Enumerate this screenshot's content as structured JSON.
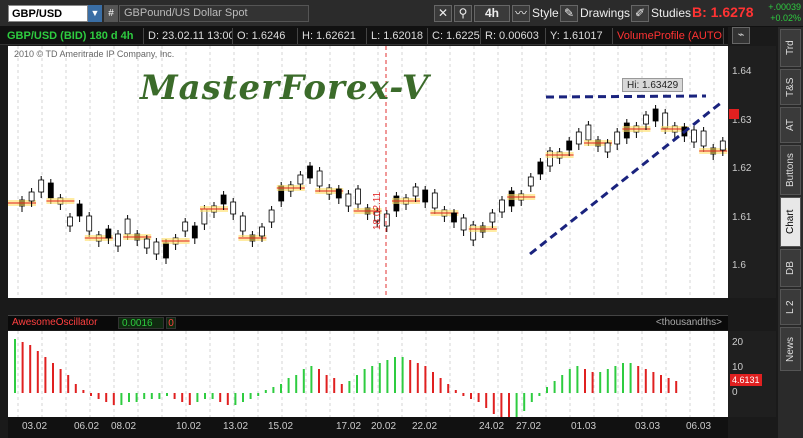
{
  "toolbar": {
    "symbol": "GBP/USD",
    "symbol_description": "GBPound/US Dollar Spot",
    "timeframe": "4h",
    "style_label": "Style",
    "drawings_label": "Drawings",
    "studies_label": "Studies",
    "bid_label": "B: 1.6278",
    "change_abs": "+.00039",
    "change_pct": "+0.02%"
  },
  "infobar": {
    "instrument": "GBP/USD (BID) 180 d 4h",
    "date": "D: 23.02.11 13:00",
    "open": "O: 1.6246",
    "high": "H: 1.62621",
    "low": "L: 1.62018",
    "close": "C: 1.6225",
    "range": "R: 0.00603",
    "y": "Y: 1.61017",
    "volume_profile": "VolumeProfile (AUTOMA..."
  },
  "chart_text": {
    "copyright": "2010 © TD Ameritrade IP Company, Inc.",
    "watermark": "MasterForex-V",
    "high_label": "Hi: 1.63429",
    "date_marker": "18.02.11"
  },
  "price_axis": [
    "1.64",
    "1.63",
    "1.62",
    "1.61",
    "1.6"
  ],
  "oscillator": {
    "title": "AwesomeOscillator",
    "value": "0.0016",
    "zero": "0",
    "units": "<thousandths>",
    "axis": [
      "20",
      "10",
      "0"
    ],
    "current_badge": "4.6131"
  },
  "time_axis": [
    "03.02",
    "06.02",
    "08.02",
    "10.02",
    "13.02",
    "15.02",
    "17.02",
    "20.02",
    "22.02",
    "24.02",
    "27.02",
    "01.03",
    "03.03",
    "06.03"
  ],
  "sidebar_tabs": [
    "Trd",
    "T&S",
    "AT",
    "Buttons",
    "Chart",
    "DB",
    "L 2",
    "News"
  ],
  "colors": {
    "bull": "#2ecc40",
    "bear": "#e02020",
    "trendline": "#1a237e",
    "candle": "#000000",
    "highlight": "#ffe066"
  },
  "chart_data": {
    "type": "candlestick",
    "x_range": [
      "03.02",
      "06.03"
    ],
    "ylim": [
      1.6,
      1.645
    ],
    "high_value": 1.63429,
    "annotations": [
      "Hi: 1.63429",
      "18.02.11"
    ],
    "oscillator_ylim": [
      -4,
      20
    ]
  }
}
